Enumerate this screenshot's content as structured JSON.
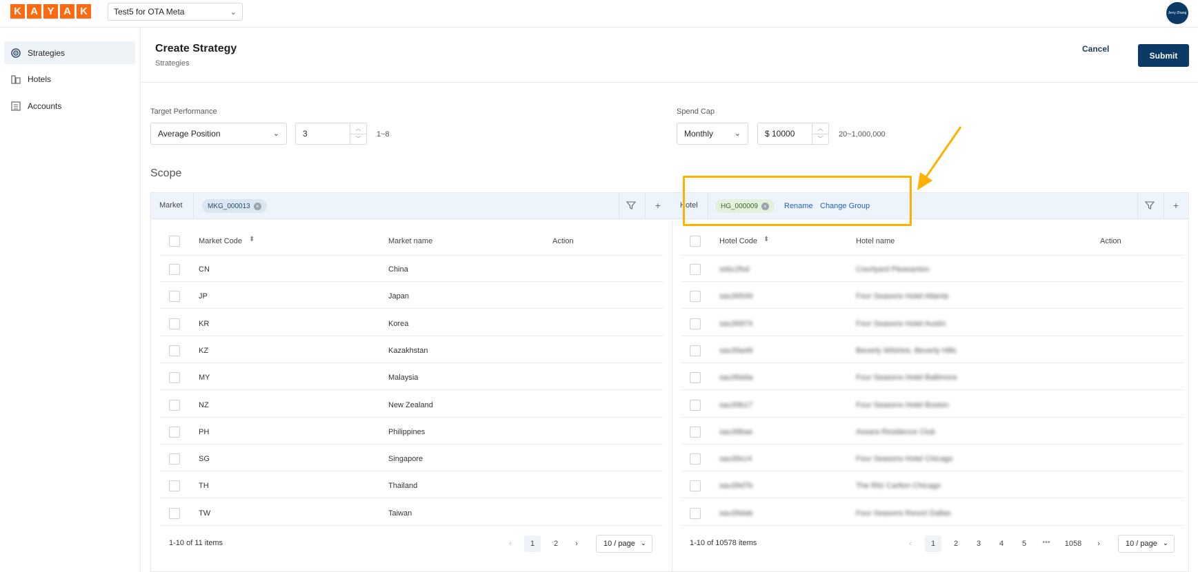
{
  "topbar": {
    "logo_letters": [
      "K",
      "A",
      "Y",
      "A",
      "K"
    ],
    "account_select": "Test5 for OTA Meta",
    "avatar_text": "Jerry Zhang"
  },
  "sidebar": {
    "items": [
      {
        "label": "Strategies",
        "icon": "target-icon",
        "active": true
      },
      {
        "label": "Hotels",
        "icon": "building-icon",
        "active": false
      },
      {
        "label": "Accounts",
        "icon": "ledger-icon",
        "active": false
      }
    ]
  },
  "header": {
    "title": "Create Strategy",
    "breadcrumb": "Strategies",
    "cancel_label": "Cancel",
    "submit_label": "Submit"
  },
  "target": {
    "label": "Target Performance",
    "metric": "Average Position",
    "value": "3",
    "range_hint": "1~8"
  },
  "spend": {
    "label": "Spend Cap",
    "period": "Monthly",
    "value": "$ 10000",
    "range_hint": "20~1,000,000"
  },
  "scope": {
    "title": "Scope",
    "market": {
      "label": "Market",
      "group_tag": "MKG_000013",
      "columns": [
        "Market Code",
        "Market name",
        "Action"
      ],
      "rows": [
        {
          "code": "CN",
          "name": "China"
        },
        {
          "code": "JP",
          "name": "Japan"
        },
        {
          "code": "KR",
          "name": "Korea"
        },
        {
          "code": "KZ",
          "name": "Kazakhstan"
        },
        {
          "code": "MY",
          "name": "Malaysia"
        },
        {
          "code": "NZ",
          "name": "New Zealand"
        },
        {
          "code": "PH",
          "name": "Philippines"
        },
        {
          "code": "SG",
          "name": "Singapore"
        },
        {
          "code": "TH",
          "name": "Thailand"
        },
        {
          "code": "TW",
          "name": "Taiwan"
        }
      ],
      "total": "1-10 of 11 items",
      "pages": [
        "1",
        "2"
      ],
      "page_size": "10 / page"
    },
    "hotel": {
      "label": "Hotel",
      "group_tag": "HG_000009",
      "rename_label": "Rename",
      "change_group_label": "Change Group",
      "columns": [
        "Hotel Code",
        "Hotel name",
        "Action"
      ],
      "rows": [
        {
          "code": "ssbc2fsd",
          "name": "Courtyard Pleasanton"
        },
        {
          "code": "sau39549",
          "name": "Four Seasons Hotel Atlanta"
        },
        {
          "code": "sau39974",
          "name": "Four Seasons Hotel Austin"
        },
        {
          "code": "sau39a48",
          "name": "Beverly Wilshire, Beverly Hills"
        },
        {
          "code": "sau39a9a",
          "name": "Four Seasons Hotel Baltimore"
        },
        {
          "code": "sau39b17",
          "name": "Four Seasons Hotel Boston"
        },
        {
          "code": "sau39bae",
          "name": "Assara Residence Club"
        },
        {
          "code": "sau39cc4",
          "name": "Four Seasons Hotel Chicago"
        },
        {
          "code": "sau39d7b",
          "name": "The Ritz Carlton Chicago"
        },
        {
          "code": "sau39dab",
          "name": "Four Seasons Resort Dallas"
        }
      ],
      "total": "1-10 of 10578 items",
      "pages": [
        "1",
        "2",
        "3",
        "4",
        "5",
        "•••",
        "1058"
      ],
      "page_size": "10 / page"
    }
  },
  "colors": {
    "brand": "#ff690f",
    "primary": "#0b3a66",
    "link": "#1f5fbf",
    "highlight": "#ffb000"
  }
}
